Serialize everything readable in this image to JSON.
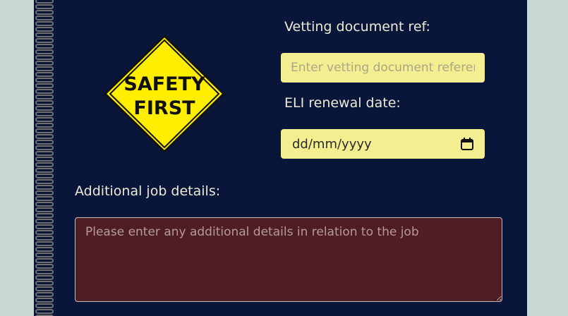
{
  "form": {
    "vetting_label": "Vetting document ref:",
    "vetting_placeholder": "Enter vetting document reference",
    "eli_label": "ELI renewal date:",
    "eli_value": "dd/mm/yyyy",
    "details_label": "Additional job details:",
    "details_placeholder": "Please enter any additional details in relation to the job"
  },
  "sign": {
    "line1": "SAFETY",
    "line2": "FIRST",
    "color": "#ffee00"
  },
  "icons": {
    "calendar": "calendar-icon"
  }
}
